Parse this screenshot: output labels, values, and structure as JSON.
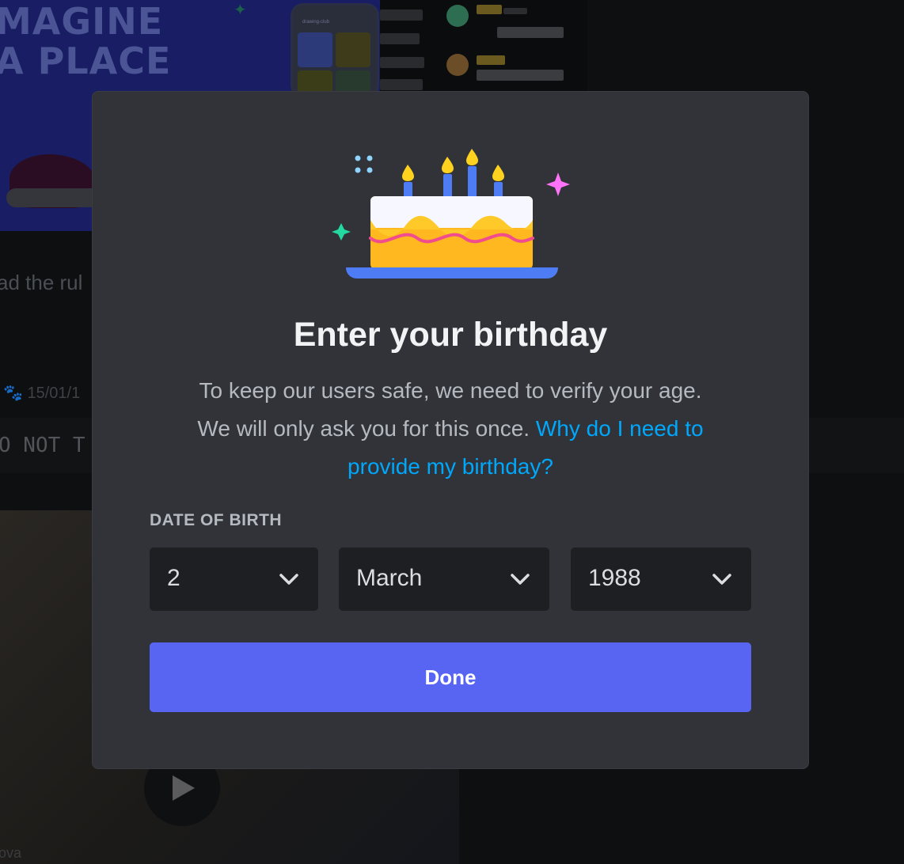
{
  "background": {
    "banner_title_line1": "MAGINE",
    "banner_title_line2": "A PLACE",
    "phone_caption": "drawing-club",
    "message_text_fragment": "ad the rul",
    "message_meta_fragment": "15/01/1",
    "code_fragment": "O NOT T",
    "bottom_fragment": "ova"
  },
  "modal": {
    "title": "Enter your birthday",
    "description": "To keep our users safe, we need to verify your age. We will only ask you for this once.",
    "description_link": "Why do I need to provide my birthday?",
    "dob_label": "DATE OF BIRTH",
    "day": {
      "value": "2"
    },
    "month": {
      "value": "March"
    },
    "year": {
      "value": "1988"
    },
    "done_label": "Done"
  },
  "colors": {
    "modal_bg": "#313338",
    "select_bg": "#1e1f22",
    "button_bg": "#5865f2",
    "link": "#00a8fc",
    "title": "#f2f3f5",
    "body_text": "#b5bac1"
  },
  "icons": {
    "cake": "birthday-cake-icon",
    "select_chevron": "chevron-down-icon"
  }
}
